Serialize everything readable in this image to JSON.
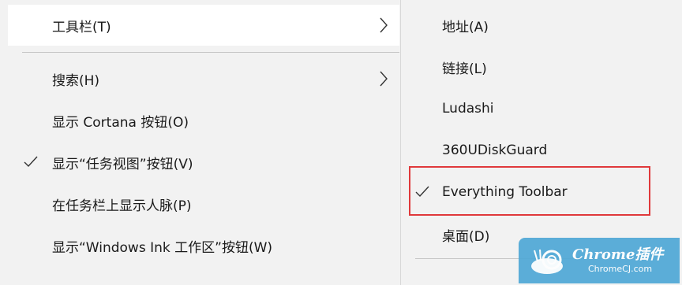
{
  "left_menu": {
    "items": [
      {
        "label": "工具栏(T)",
        "has_submenu": true,
        "checked": false,
        "hover": true
      },
      {
        "label": "搜索(H)",
        "has_submenu": true,
        "checked": false
      },
      {
        "label": "显示 Cortana 按钮(O)",
        "has_submenu": false,
        "checked": false
      },
      {
        "label": "显示“任务视图”按钮(V)",
        "has_submenu": false,
        "checked": true
      },
      {
        "label": "在任务栏上显示人脉(P)",
        "has_submenu": false,
        "checked": false
      },
      {
        "label": "显示“Windows Ink 工作区”按钮(W)",
        "has_submenu": false,
        "checked": false
      }
    ]
  },
  "right_menu": {
    "items": [
      {
        "label": "地址(A)",
        "checked": false
      },
      {
        "label": "链接(L)",
        "checked": false
      },
      {
        "label": "Ludashi",
        "checked": false
      },
      {
        "label": "360UDiskGuard",
        "checked": false
      },
      {
        "label": "Everything Toolbar",
        "checked": true,
        "highlighted": true
      },
      {
        "label": "桌面(D)",
        "checked": false
      }
    ]
  },
  "watermark": {
    "title": "Chrome插件",
    "subtitle": "ChromeCJ.com"
  },
  "colors": {
    "menu_bg": "#f2f2f2",
    "hover_bg": "#ffffff",
    "highlight_border": "#e0393b",
    "watermark_bg": "#4fa8d6"
  },
  "icons": {
    "submenu_arrow": "chevron-right-icon",
    "checkmark": "check-icon"
  }
}
